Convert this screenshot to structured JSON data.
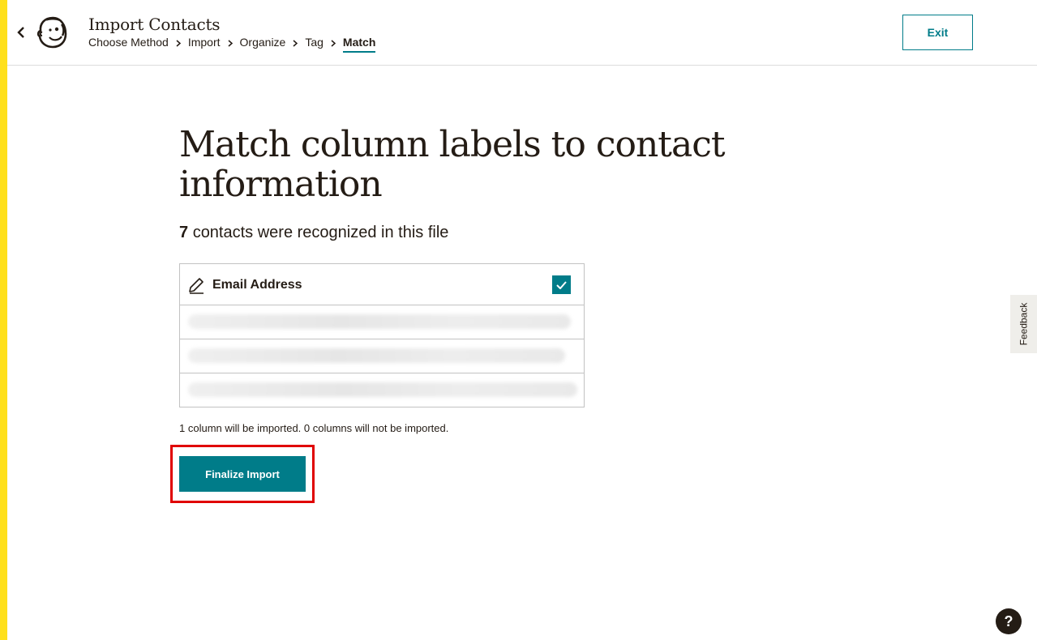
{
  "header": {
    "title": "Import Contacts",
    "exit_label": "Exit",
    "breadcrumb": [
      "Choose Method",
      "Import",
      "Organize",
      "Tag",
      "Match"
    ],
    "active_step": "Match"
  },
  "main": {
    "heading": "Match column labels to contact information",
    "contacts_count": "7",
    "contacts_suffix": "contacts were recognized in this file",
    "column": {
      "label": "Email Address",
      "checked": true
    },
    "import_note": "1 column will be imported. 0 columns will not be imported.",
    "finalize_label": "Finalize Import"
  },
  "side": {
    "feedback_label": "Feedback",
    "help_label": "?"
  },
  "colors": {
    "accent": "#007c89",
    "brand_strip": "#ffe01b",
    "highlight": "#e00000",
    "text": "#241c15"
  },
  "icons": [
    "chevron-left-icon",
    "mailchimp-logo",
    "chevron-right-icon",
    "pencil-icon",
    "check-icon"
  ]
}
